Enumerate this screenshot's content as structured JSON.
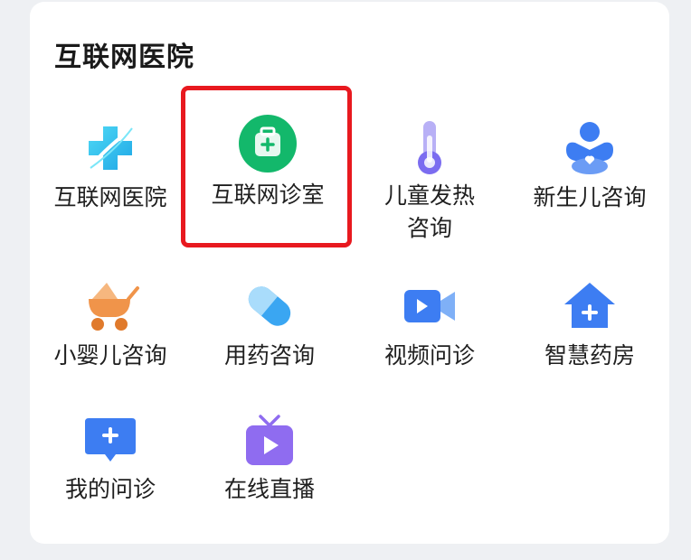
{
  "section": {
    "title": "互联网医院"
  },
  "items": [
    {
      "label": "互联网医院",
      "icon": "hospital-cross-icon",
      "color": "#27c4e8"
    },
    {
      "label": "互联网诊室",
      "icon": "medical-kit-icon",
      "color": "#13b86b",
      "highlighted": true
    },
    {
      "label": "儿童发热\n咨询",
      "label_line1": "儿童发热",
      "label_line2": "咨询",
      "icon": "thermometer-icon",
      "color": "#7b6cf0"
    },
    {
      "label": "新生儿咨询",
      "icon": "baby-icon",
      "color": "#3d7df2"
    },
    {
      "label": "小婴儿咨询",
      "icon": "stroller-icon",
      "color": "#f0944a"
    },
    {
      "label": "用药咨询",
      "icon": "capsule-icon",
      "color": "#3aa6f2"
    },
    {
      "label": "视频问诊",
      "icon": "video-icon",
      "color": "#3d7df2"
    },
    {
      "label": "智慧药房",
      "icon": "pharmacy-house-icon",
      "color": "#3d7df2"
    },
    {
      "label": "我的问诊",
      "icon": "chat-plus-icon",
      "color": "#3d7df2"
    },
    {
      "label": "在线直播",
      "icon": "tv-live-icon",
      "color": "#8f6cf0"
    }
  ],
  "colors": {
    "highlight_border": "#e8191f",
    "card_bg": "#ffffff",
    "page_bg": "#eef0f3"
  }
}
